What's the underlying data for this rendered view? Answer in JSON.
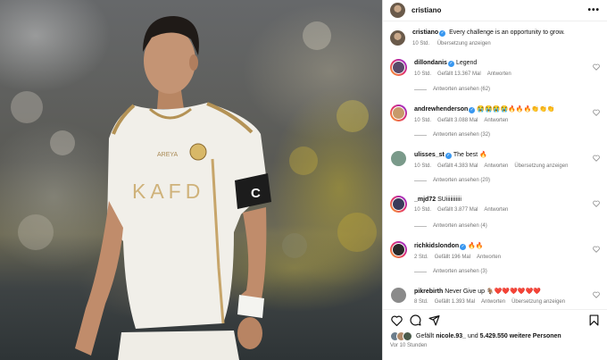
{
  "post": {
    "username": "cristiano",
    "more_icon": "more-horizontal-icon",
    "caption": {
      "username": "cristiano",
      "text": "Every challenge is an opportunity to grow.",
      "time": "10 Std.",
      "translate": "Übersetzung anzeigen"
    },
    "photo": {
      "sponsor_text": "KAFD",
      "sleeve_text": "AREYA",
      "captain_band": "C"
    }
  },
  "comments": [
    {
      "username": "dillondanis",
      "verified": true,
      "text": "Legend",
      "time": "10 Std.",
      "likes": "Gefällt 13.367 Mal",
      "reply": "Antworten",
      "translate": "",
      "view_replies": "Antworten ansehen (62)",
      "ring": true,
      "pic_color": "#5a4a6a"
    },
    {
      "username": "andrewhenderson",
      "verified": true,
      "text": "😭😭😭😭🔥🔥🔥👏👏👏",
      "time": "10 Std.",
      "likes": "Gefällt 3.088 Mal",
      "reply": "Antworten",
      "translate": "",
      "view_replies": "Antworten ansehen (32)",
      "ring": true,
      "pic_color": "#c79a6b"
    },
    {
      "username": "ulisses_st",
      "verified": true,
      "text": "The best 🔥",
      "time": "10 Std.",
      "likes": "Gefällt 4.383 Mal",
      "reply": "Antworten",
      "translate": "Übersetzung anzeigen",
      "view_replies": "Antworten ansehen (20)",
      "ring": false,
      "pic_color": "#7a9a8a"
    },
    {
      "username": "_mjd72",
      "verified": false,
      "text": "SUiiiiiiiiiii",
      "time": "10 Std.",
      "likes": "Gefällt 3.877 Mal",
      "reply": "Antworten",
      "translate": "",
      "view_replies": "Antworten ansehen (4)",
      "ring": true,
      "pic_color": "#3a3a5a"
    },
    {
      "username": "richkidslondon",
      "verified": true,
      "text": "🔥🔥",
      "time": "2 Std.",
      "likes": "Gefällt 196 Mal",
      "reply": "Antworten",
      "translate": "",
      "view_replies": "Antworten ansehen (3)",
      "ring": true,
      "pic_color": "#2a2a2a"
    },
    {
      "username": "pikrebirth",
      "verified": false,
      "text": "Never Give up 🐐❤️❤️❤️❤️❤️❤️",
      "time": "8 Std.",
      "likes": "Gefällt 1.393 Mal",
      "reply": "Antworten",
      "translate": "Übersetzung anzeigen",
      "view_replies": "",
      "ring": false,
      "pic_color": "#8a8a8a"
    }
  ],
  "actions": {
    "like_icon": "heart-icon",
    "comment_icon": "comment-icon",
    "share_icon": "share-icon",
    "save_icon": "bookmark-icon"
  },
  "likes": {
    "prefix": "Gefällt",
    "first_user": "nicole.93_",
    "middle": "und",
    "count": "5.429.550 weitere Personen"
  },
  "posted_ago": "Vor 10 Stunden"
}
